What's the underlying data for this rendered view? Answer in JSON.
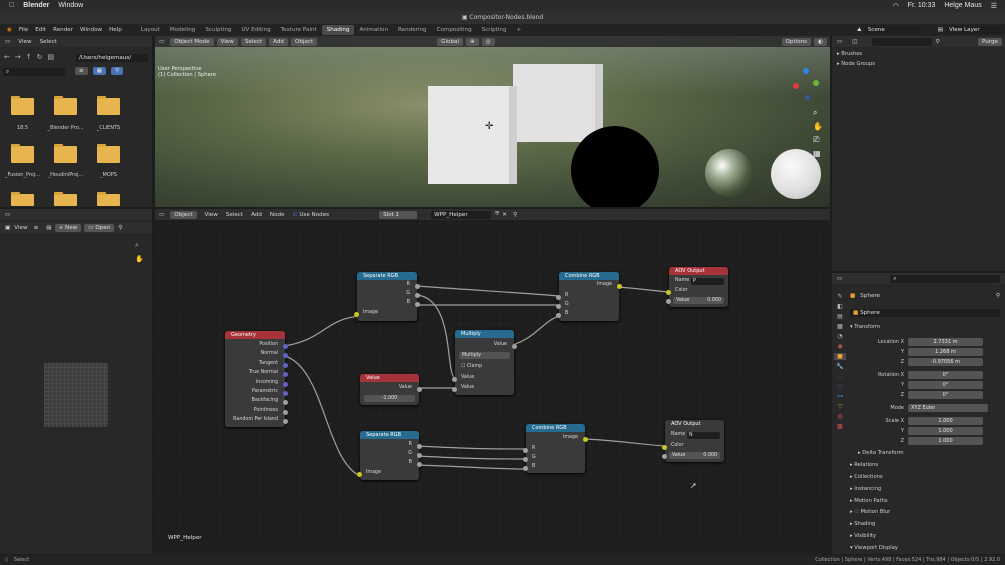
{
  "mac_menu": {
    "app": "Blender",
    "items": [
      "Window"
    ],
    "clock": "Fr. 10:33",
    "user": "Helge Maus"
  },
  "window_title": "Compositor-Nodes.blend",
  "blender_menu": [
    "File",
    "Edit",
    "Render",
    "Window",
    "Help"
  ],
  "workspaces": [
    "Layout",
    "Modeling",
    "Sculpting",
    "UV Editing",
    "Texture Paint",
    "Shading",
    "Animation",
    "Rendering",
    "Compositing",
    "Scripting"
  ],
  "active_workspace": "Shading",
  "scene": "Scene",
  "view_layer": "View Layer",
  "file_browser": {
    "menu": [
      "View",
      "Select"
    ],
    "path": "/Users/helgemaus/",
    "folders": [
      "18.5",
      "_Blender Pro...",
      "_CLIENTS",
      "_Fusion_Proj...",
      "_HoudiniProj...",
      "_MOPS",
      "",
      ""
    ]
  },
  "viewport": {
    "mode": "Object Mode",
    "menu": [
      "View",
      "Select",
      "Add",
      "Object"
    ],
    "orientation": "Global",
    "options": "Options",
    "overlay_line1": "User Perspective",
    "overlay_line2": "(1) Collection | Sphere"
  },
  "outliner": {
    "search": "",
    "purge": "Purge",
    "items": [
      "Brushes",
      "Node Groups"
    ]
  },
  "node_editor": {
    "type": "Object",
    "menu": [
      "View",
      "Select",
      "Add",
      "Node"
    ],
    "use_nodes": "Use Nodes",
    "slot": "Slot 1",
    "material": "WPP_Helper",
    "footer_label": "WPP_Helper"
  },
  "image_editor": {
    "view": "View",
    "new": "New",
    "open": "Open"
  },
  "nodes": {
    "sep1": {
      "title": "Separate RGB",
      "r": "R",
      "g": "G",
      "b": "B",
      "image": "Image"
    },
    "comb1": {
      "title": "Combine RGB",
      "image": "Image",
      "r": "R",
      "g": "G",
      "b": "B"
    },
    "aov1": {
      "title": "AOV Output",
      "name_label": "Name",
      "name": "P",
      "color": "Color",
      "value_label": "Value",
      "value": "0.000"
    },
    "geometry": {
      "title": "Geometry",
      "outputs": [
        "Position",
        "Normal",
        "Tangent",
        "True Normal",
        "Incoming",
        "Parametric",
        "Backfacing",
        "Pointiness",
        "Random Per Island"
      ]
    },
    "multiply": {
      "title": "Multiply",
      "value": "Value",
      "op": "Multiply",
      "clamp": "Clamp",
      "in1": "Value",
      "in2": "Value"
    },
    "value": {
      "title": "Value",
      "out": "Value",
      "val": "-1.000"
    },
    "sep2": {
      "title": "Separate RGB",
      "r": "R",
      "g": "G",
      "b": "B",
      "image": "Image"
    },
    "comb2": {
      "title": "Combine RGB",
      "image": "Image",
      "r": "R",
      "g": "G",
      "b": "B"
    },
    "aov2": {
      "title": "AOV Output",
      "name_label": "Name",
      "name": "N",
      "color": "Color",
      "value_label": "Value",
      "value": "0.000"
    }
  },
  "properties": {
    "object": "Sphere",
    "data": "Sphere",
    "transform": "Transform",
    "location_label": "Location X",
    "loc": [
      "2.7331 m",
      "1.268 m",
      "-0.97056 m"
    ],
    "rotation_label": "Rotation X",
    "rot": [
      "0°",
      "0°",
      "0°"
    ],
    "mode_label": "Mode",
    "mode": "XYZ Euler",
    "scale_label": "Scale X",
    "scale": [
      "1.000",
      "1.000",
      "1.000"
    ],
    "axis": [
      "Y",
      "Z"
    ],
    "sections": [
      "Delta Transform",
      "Relations",
      "Collections",
      "Instancing",
      "Motion Paths",
      "Motion Blur",
      "Shading",
      "Visibility",
      "Viewport Display"
    ]
  },
  "status": {
    "left": "Select",
    "right": "Collection | Sphere | Verts:498 | Faces:524 | Tris:984 | Objects:0/5 | 2.92.0"
  }
}
